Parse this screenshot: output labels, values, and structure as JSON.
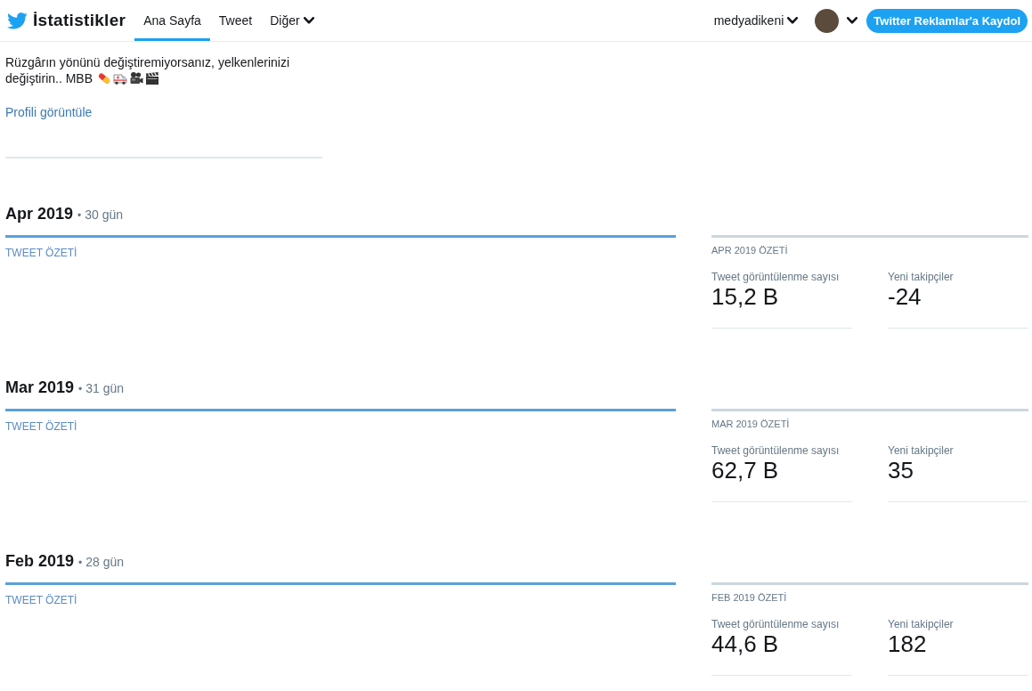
{
  "header": {
    "title": "İstatistikler",
    "tabs": [
      {
        "label": "Ana Sayfa",
        "selected": true,
        "kind": "link"
      },
      {
        "label": "Tweet",
        "selected": false,
        "kind": "link"
      },
      {
        "label": "Diğer",
        "selected": false,
        "kind": "menu"
      }
    ],
    "account": "medyadikeni",
    "cta": "Twitter Reklamlar'a Kaydol"
  },
  "profile": {
    "bio_lines": [
      "Rüzgârın yönünü değiştiremiyorsanız, yelkenlerinizi",
      "değiştirin.. MBB"
    ],
    "link": "Profili görüntüle"
  },
  "months": [
    {
      "title": "Apr 2019",
      "separator": "•",
      "days": "30 gün",
      "tweet_summary": "TWEET ÖZETİ",
      "summary_title": "APR 2019 ÖZETİ",
      "metrics": [
        {
          "label": "Tweet görüntülenme sayısı",
          "value": "15,2 B"
        },
        {
          "label": "Yeni takipçiler",
          "value": "-24"
        }
      ]
    },
    {
      "title": "Mar 2019",
      "separator": "•",
      "days": "31 gün",
      "tweet_summary": "TWEET ÖZETİ",
      "summary_title": "MAR 2019 ÖZETİ",
      "metrics": [
        {
          "label": "Tweet görüntülenme sayısı",
          "value": "62,7 B"
        },
        {
          "label": "Yeni takipçiler",
          "value": "35"
        }
      ]
    },
    {
      "title": "Feb 2019",
      "separator": "•",
      "days": "28 gün",
      "tweet_summary": "TWEET ÖZETİ",
      "summary_title": "FEB 2019 ÖZETİ",
      "metrics": [
        {
          "label": "Tweet görüntülenme sayısı",
          "value": "44,6 B"
        },
        {
          "label": "Yeni takipçiler",
          "value": "182"
        }
      ]
    }
  ]
}
